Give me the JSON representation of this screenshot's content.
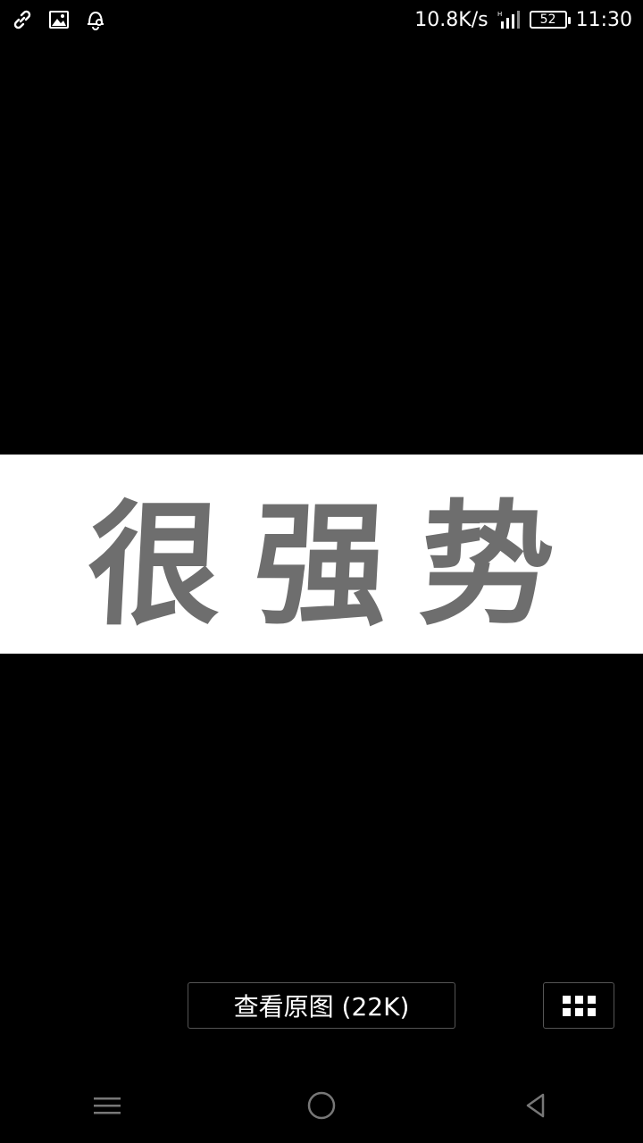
{
  "status_bar": {
    "icons_left": [
      "link-icon",
      "image-icon",
      "notification-bell-icon"
    ],
    "net_speed": "10.8K/s",
    "signal_icon": "signal-icon",
    "battery_level": "52",
    "time": "11:30"
  },
  "viewer": {
    "image_text": "很强势",
    "view_original_label": "查看原图 (22K)",
    "grid_icon": "grid-icon"
  },
  "nav_bar": {
    "menu_icon": "menu-icon",
    "home_icon": "home-circle-icon",
    "back_icon": "back-triangle-icon"
  },
  "colors": {
    "background": "#000000",
    "image_background": "#ffffff",
    "image_text": "#6e6e6e",
    "button_border": "#555555",
    "nav_icon": "#777777"
  }
}
